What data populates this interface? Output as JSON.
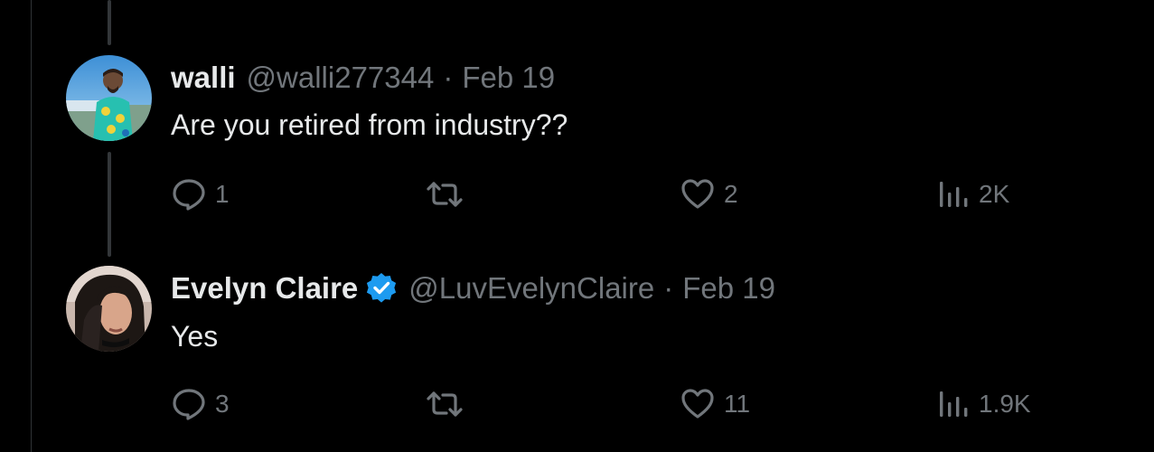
{
  "colors": {
    "background": "#000000",
    "primary_text": "#e7e9ea",
    "secondary_text": "#71767b",
    "verified_badge": "#1d9bf0",
    "thread_line": "#333639"
  },
  "replies": [
    {
      "display_name": "walli",
      "handle": "@walli277344",
      "separator": "·",
      "timestamp": "Feb 19",
      "text": "Are you retired from industry??",
      "verified": false,
      "actions": {
        "reply_count": "1",
        "retweet_count": "",
        "like_count": "2",
        "view_count": "2K"
      }
    },
    {
      "display_name": "Evelyn Claire",
      "handle": "@LuvEvelynClaire",
      "separator": "·",
      "timestamp": "Feb 19",
      "text": "Yes",
      "verified": true,
      "actions": {
        "reply_count": "3",
        "retweet_count": "",
        "like_count": "11",
        "view_count": "1.9K"
      }
    }
  ],
  "icons": {
    "reply": "reply-bubble-icon",
    "retweet": "retweet-arrows-icon",
    "like": "heart-icon",
    "views": "views-bar-chart-icon",
    "verified": "verified-badge-icon"
  }
}
